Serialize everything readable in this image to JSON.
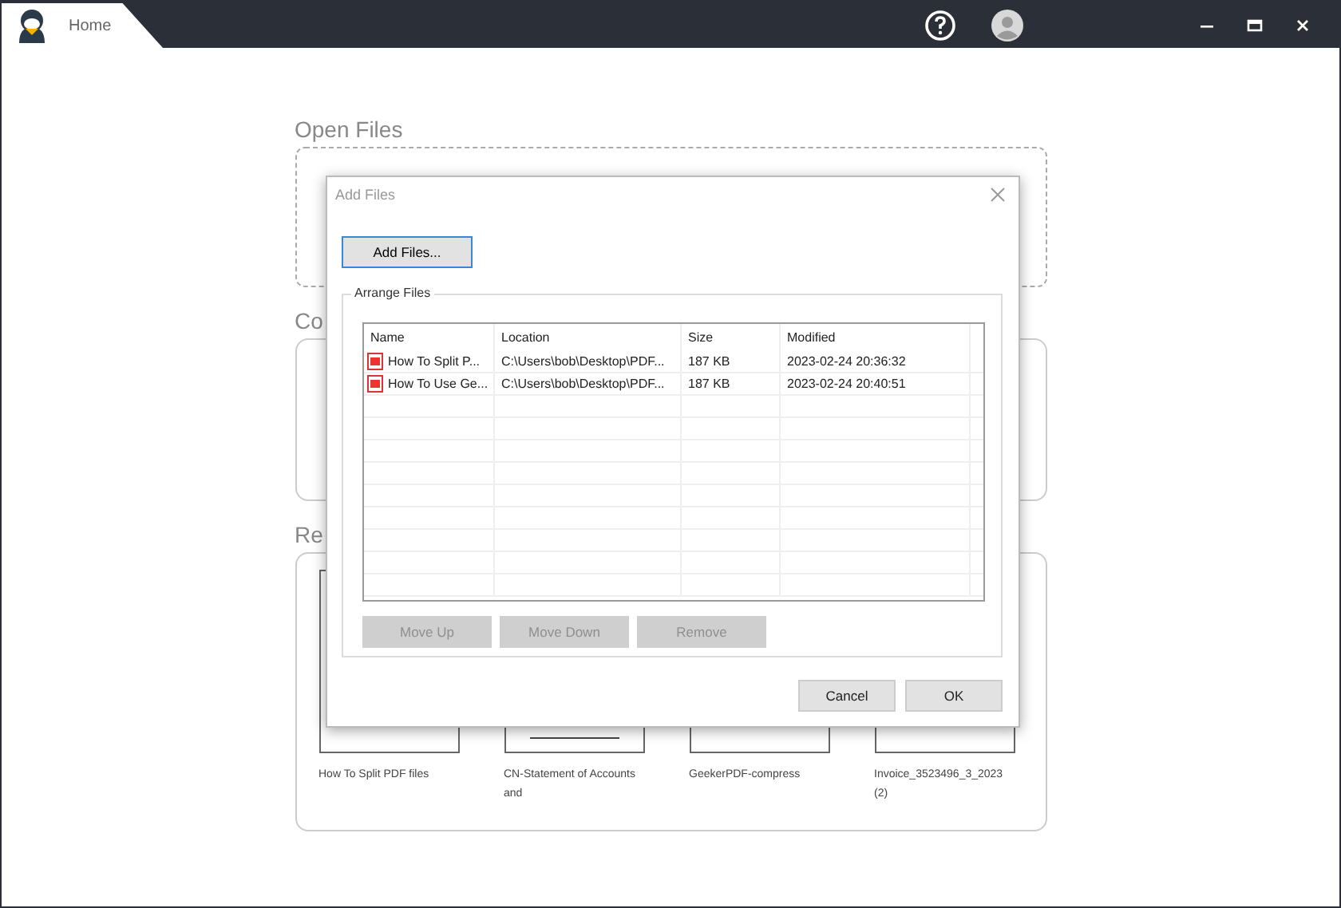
{
  "window": {
    "tab": "Home"
  },
  "open_files": {
    "heading": "Open Files"
  },
  "section_2": {
    "heading": "Co"
  },
  "recent": {
    "heading": "Re",
    "items": [
      {
        "name": "How To Split PDF files"
      },
      {
        "name": "CN-Statement of Accounts and"
      },
      {
        "name": "GeekerPDF-compress"
      },
      {
        "name": "Invoice_3523496_3_2023 (2)"
      }
    ]
  },
  "dialog": {
    "title": "Add Files",
    "add_button": "Add Files...",
    "group_title": "Arrange Files",
    "columns": [
      "Name",
      "Location",
      "Size",
      "Modified"
    ],
    "rows": [
      {
        "name": "How To Split P...",
        "location": "C:\\Users\\bob\\Desktop\\PDF...",
        "size": "187 KB",
        "modified": "2023-02-24 20:36:32"
      },
      {
        "name": "How To Use Ge...",
        "location": "C:\\Users\\bob\\Desktop\\PDF...",
        "size": "187 KB",
        "modified": "2023-02-24 20:40:51"
      }
    ],
    "list_buttons": [
      {
        "label": "Move Up",
        "disabled": true
      },
      {
        "label": "Move Down",
        "disabled": true
      },
      {
        "label": "Remove",
        "disabled": true
      }
    ],
    "footer_buttons": [
      {
        "label": "Cancel"
      },
      {
        "label": "OK"
      }
    ]
  }
}
